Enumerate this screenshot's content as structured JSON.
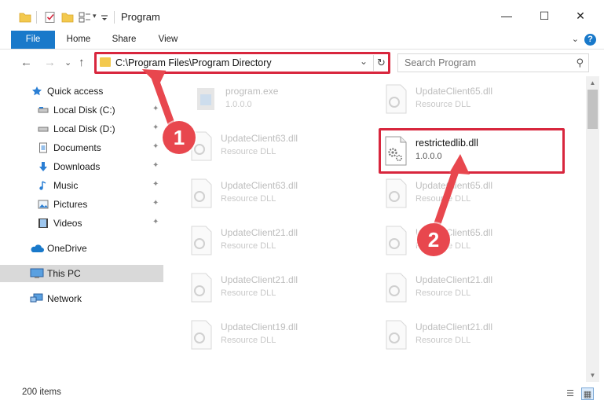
{
  "window": {
    "title": "Program",
    "minimize_glyph": "—",
    "maximize_glyph": "☐",
    "close_glyph": "✕"
  },
  "ribbon": {
    "tabs": [
      "File",
      "Home",
      "Share",
      "View"
    ],
    "help_glyph": "?",
    "collapse_glyph": "⌄"
  },
  "nav": {
    "back_glyph": "←",
    "forward_glyph": "→",
    "recent_glyph": "⌄",
    "up_glyph": "↑"
  },
  "address": {
    "path": "C:\\Program Files\\Program Directory",
    "dropdown_glyph": "⌄",
    "refresh_glyph": "↻"
  },
  "search": {
    "placeholder": "Search Program",
    "icon": "search-icon",
    "icon_glyph": "⚲"
  },
  "sidebar": {
    "pin_glyph": "📌",
    "items": [
      {
        "label": "Quick access",
        "icon": "star-icon"
      },
      {
        "label": "Local Disk (C:)",
        "icon": "drive-icon",
        "pinned": true
      },
      {
        "label": "Local Disk (D:)",
        "icon": "drive-icon",
        "pinned": true
      },
      {
        "label": "Documents",
        "icon": "documents-icon",
        "pinned": true
      },
      {
        "label": "Downloads",
        "icon": "downloads-icon",
        "pinned": true
      },
      {
        "label": "Music",
        "icon": "music-icon",
        "pinned": true
      },
      {
        "label": "Pictures",
        "icon": "pictures-icon",
        "pinned": true
      },
      {
        "label": "Videos",
        "icon": "videos-icon",
        "pinned": true
      },
      {
        "label": "OneDrive",
        "icon": "cloud-icon"
      },
      {
        "label": "This PC",
        "icon": "computer-icon",
        "selected": true
      },
      {
        "label": "Network",
        "icon": "network-icon"
      }
    ]
  },
  "files": [
    {
      "name": "program.exe",
      "type": "1.0.0.0",
      "icon": "exe-icon"
    },
    {
      "name": "UpdateClient65.dll",
      "type": "Resource DLL",
      "icon": "dll-icon"
    },
    {
      "name": "UpdateClient63.dll",
      "type": "Resource DLL",
      "icon": "dll-icon"
    },
    {
      "name": "restrictedlib.dll",
      "type": "1.0.0.0",
      "icon": "dll-gear-icon",
      "focus": true
    },
    {
      "name": "UpdateClient63.dll",
      "type": "Resource DLL",
      "icon": "dll-icon"
    },
    {
      "name": "UpdateClient65.dll",
      "type": "Resource DLL",
      "icon": "dll-icon"
    },
    {
      "name": "UpdateClient21.dll",
      "type": "Resource DLL",
      "icon": "dll-icon"
    },
    {
      "name": "UpdateClient65.dll",
      "type": "Resource DLL",
      "icon": "dll-icon"
    },
    {
      "name": "UpdateClient21.dll",
      "type": "Resource DLL",
      "icon": "dll-icon"
    },
    {
      "name": "UpdateClient21.dll",
      "type": "Resource DLL",
      "icon": "dll-icon"
    },
    {
      "name": "UpdateClient19.dll",
      "type": "Resource DLL",
      "icon": "dll-icon"
    },
    {
      "name": "UpdateClient21.dll",
      "type": "Resource DLL",
      "icon": "dll-icon"
    }
  ],
  "status": {
    "item_count": "200 items",
    "details_view_glyph": "☰",
    "tiles_view_glyph": "▦"
  },
  "annotations": {
    "callout_1": "1",
    "callout_2": "2"
  },
  "colors": {
    "accent": "#1979ca",
    "highlight": "#d8263d",
    "callout": "#e8474e",
    "selection": "#d9d9d9"
  }
}
